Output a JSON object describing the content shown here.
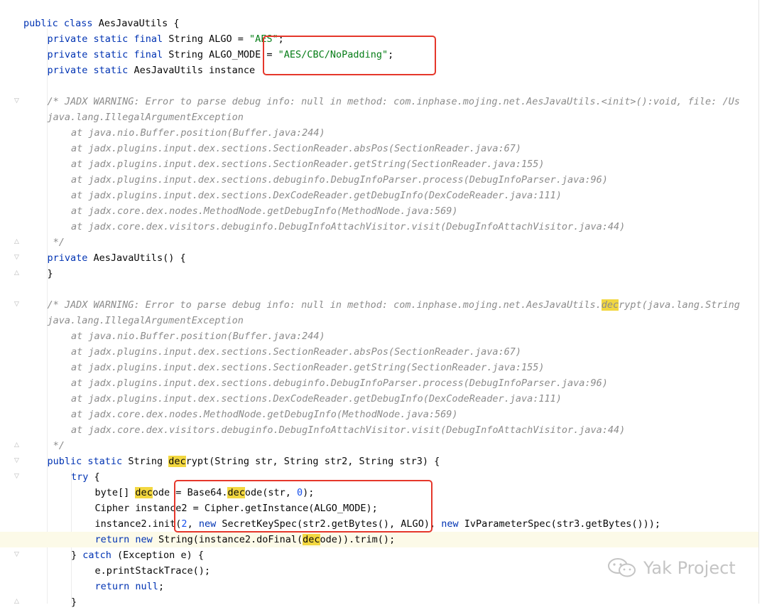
{
  "code": {
    "line_class": "public class AesJavaUtils {",
    "line_algo": "private static final String ALGO = \"AES\";",
    "line_algo_mode": "private static final String ALGO_MODE = \"AES/CBC/NoPadding\";",
    "line_instance": "private static AesJavaUtils instance",
    "comment1": {
      "header": "/* JADX WARNING: Error to parse debug info: null in method: com.inphase.mojing.net.AesJavaUtils.<init>():void, file: /Us",
      "exception": "java.lang.IllegalArgumentException",
      "stack": [
        "at java.nio.Buffer.position(Buffer.java:244)",
        "at jadx.plugins.input.dex.sections.SectionReader.absPos(SectionReader.java:67)",
        "at jadx.plugins.input.dex.sections.SectionReader.getString(SectionReader.java:155)",
        "at jadx.plugins.input.dex.sections.debuginfo.DebugInfoParser.process(DebugInfoParser.java:96)",
        "at jadx.plugins.input.dex.sections.DexCodeReader.getDebugInfo(DexCodeReader.java:111)",
        "at jadx.core.dex.nodes.MethodNode.getDebugInfo(MethodNode.java:569)",
        "at jadx.core.dex.visitors.debuginfo.DebugInfoAttachVisitor.visit(DebugInfoAttachVisitor.java:44)"
      ],
      "close": "*/"
    },
    "line_ctor": "private AesJavaUtils() {",
    "line_ctor_close": "}",
    "comment2": {
      "header": "/* JADX WARNING: Error to parse debug info: null in method: com.inphase.mojing.net.AesJavaUtils.decrypt(java.lang.String",
      "exception": "java.lang.IllegalArgumentException",
      "stack": [
        "at java.nio.Buffer.position(Buffer.java:244)",
        "at jadx.plugins.input.dex.sections.SectionReader.absPos(SectionReader.java:67)",
        "at jadx.plugins.input.dex.sections.SectionReader.getString(SectionReader.java:155)",
        "at jadx.plugins.input.dex.sections.debuginfo.DebugInfoParser.process(DebugInfoParser.java:96)",
        "at jadx.plugins.input.dex.sections.DexCodeReader.getDebugInfo(DexCodeReader.java:111)",
        "at jadx.core.dex.nodes.MethodNode.getDebugInfo(MethodNode.java:569)",
        "at jadx.core.dex.visitors.debuginfo.DebugInfoAttachVisitor.visit(DebugInfoAttachVisitor.java:44)"
      ],
      "close": "*/"
    },
    "line_decrypt": "public static String decrypt(String str, String str2, String str3) {",
    "line_try": "try {",
    "line_decode": "byte[] decode = Base64.decode(str, 0);",
    "line_cipher": "Cipher instance2 = Cipher.getInstance(ALGO_MODE);",
    "line_init": "instance2.init(2, new SecretKeySpec(str2.getBytes(), ALGO), new IvParameterSpec(str3.getBytes()));",
    "line_return": "return new String(instance2.doFinal(decode)).trim();",
    "line_catch": "} catch (Exception e) {",
    "line_print": "e.printStackTrace();",
    "line_return_null": "return null;",
    "line_close": "}"
  },
  "watermark": {
    "text": "Yak Project",
    "icon": "wechat-icon"
  },
  "colors": {
    "keyword": "#0033b3",
    "string": "#067d17",
    "number": "#1750eb",
    "comment": "#8c8c8c",
    "search_highlight": "#f2d740",
    "annotation_box": "#e5372b"
  }
}
